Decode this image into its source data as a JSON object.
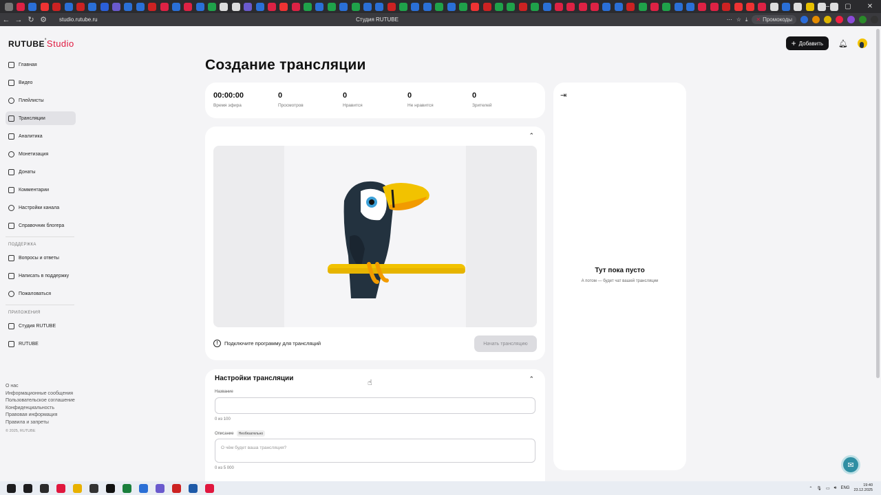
{
  "browser": {
    "url": "studio.rutube.ru",
    "tab_title": "Студия RUTUBE",
    "promo_label": "Промокоды",
    "tab_colors": [
      "#777",
      "#d24",
      "#2a6fd6",
      "#e33",
      "#c22",
      "#2a6fd6",
      "#c22",
      "#2a6fd6",
      "#2b5fd9",
      "#6a5acd",
      "#2a6fd6",
      "#2a6fd6",
      "#c22",
      "#d24",
      "#2a6fd6",
      "#d24",
      "#2a6fd6",
      "#1fa24a",
      "#ddd",
      "#ddd",
      "#6a5acd",
      "#2a6fd6",
      "#d24",
      "#e33",
      "#d24",
      "#1fa24a",
      "#2a6fd6",
      "#1fa24a",
      "#2a6fd6",
      "#1fa24a",
      "#2a6fd6",
      "#2a6fd6",
      "#c22",
      "#1fa24a",
      "#2a6fd6",
      "#2a6fd6",
      "#1fa24a",
      "#2a6fd6",
      "#1fa24a",
      "#e33",
      "#c22",
      "#1fa24a",
      "#1fa24a",
      "#c22",
      "#1fa24a",
      "#2a6fd6",
      "#d24",
      "#d24",
      "#d24",
      "#d24",
      "#2a6fd6",
      "#2a6fd6",
      "#c22",
      "#1fa24a",
      "#d24",
      "#1fa24a",
      "#2a6fd6",
      "#2a6fd6",
      "#d24",
      "#d24",
      "#c22",
      "#e33",
      "#e33",
      "#d24",
      "#ddd",
      "#2a6fd6",
      "#ddd",
      "#e8c000",
      "#ddd",
      "#ddd"
    ],
    "ext_colors": [
      "#2b6cd8",
      "#e38b00",
      "#dcb400",
      "#e24",
      "#8b4ad8",
      "#2a8a2a",
      "#333"
    ]
  },
  "app": {
    "logo_brand": "RUTUBE",
    "logo_suffix": "Studio",
    "add_label": "Добавить",
    "page_title": "Создание трансляции"
  },
  "sidebar": {
    "items": [
      {
        "label": "Главная",
        "icon": "home-icon"
      },
      {
        "label": "Видео",
        "icon": "video-icon"
      },
      {
        "label": "Плейлисты",
        "icon": "playlist-icon"
      },
      {
        "label": "Трансляции",
        "icon": "broadcast-icon"
      },
      {
        "label": "Аналитика",
        "icon": "analytics-icon"
      },
      {
        "label": "Монетизация",
        "icon": "monetization-icon"
      },
      {
        "label": "Донаты",
        "icon": "donations-icon"
      },
      {
        "label": "Комментарии",
        "icon": "comments-icon"
      },
      {
        "label": "Настройки канала",
        "icon": "settings-icon"
      },
      {
        "label": "Справочник блогера",
        "icon": "info-icon"
      }
    ],
    "support_label": "ПОДДЕРЖКА",
    "support_items": [
      {
        "label": "Вопросы и ответы",
        "icon": "question-icon"
      },
      {
        "label": "Написать в поддержку",
        "icon": "mail-icon"
      },
      {
        "label": "Пожаловаться",
        "icon": "flag-icon"
      }
    ],
    "apps_label": "ПРИЛОЖЕНИЯ",
    "apps_items": [
      {
        "label": "Студия RUTUBE",
        "icon": "studio-app-icon"
      },
      {
        "label": "RUTUBE",
        "icon": "rutube-app-icon"
      }
    ],
    "footer": [
      "О нас",
      "Информационные сообщения",
      "Пользовательское соглашение",
      "Конфиденциальность",
      "Правовая информация",
      "Правила и запреты"
    ],
    "copyright": "© 2025, RUTUBE"
  },
  "stats": [
    {
      "value": "00:00:00",
      "label": "Время эфира"
    },
    {
      "value": "0",
      "label": "Просмотров"
    },
    {
      "value": "0",
      "label": "Нравится"
    },
    {
      "value": "0",
      "label": "Не нравится"
    },
    {
      "value": "0",
      "label": "Зрителей"
    }
  ],
  "preview": {
    "connect_text": "Подключите программу для трансляций",
    "start_button": "Начать трансляцию"
  },
  "settings": {
    "title": "Настройки трансляции",
    "name_label": "Название",
    "name_counter": "0 из 100",
    "desc_label": "Описание",
    "desc_badge": "Необязательно",
    "desc_placeholder": "О чём будет ваша трансляция?",
    "desc_counter": "0 из 5 000"
  },
  "chat": {
    "empty_title": "Тут пока пусто",
    "empty_subtitle": "А потом — будет чат вашей трансляции"
  },
  "taskbar": {
    "icon_colors": [
      "#1d1d1f",
      "#1d1d1f",
      "#2b2b2b",
      "#e0173e",
      "#e8b100",
      "#333",
      "#111",
      "#1a7f3c",
      "#2a6fd6",
      "#6a5acd",
      "#c22",
      "#1e5aa8",
      "#e0173e"
    ],
    "lang": "ENG",
    "time": "19:40",
    "date": "23.12.2025"
  }
}
